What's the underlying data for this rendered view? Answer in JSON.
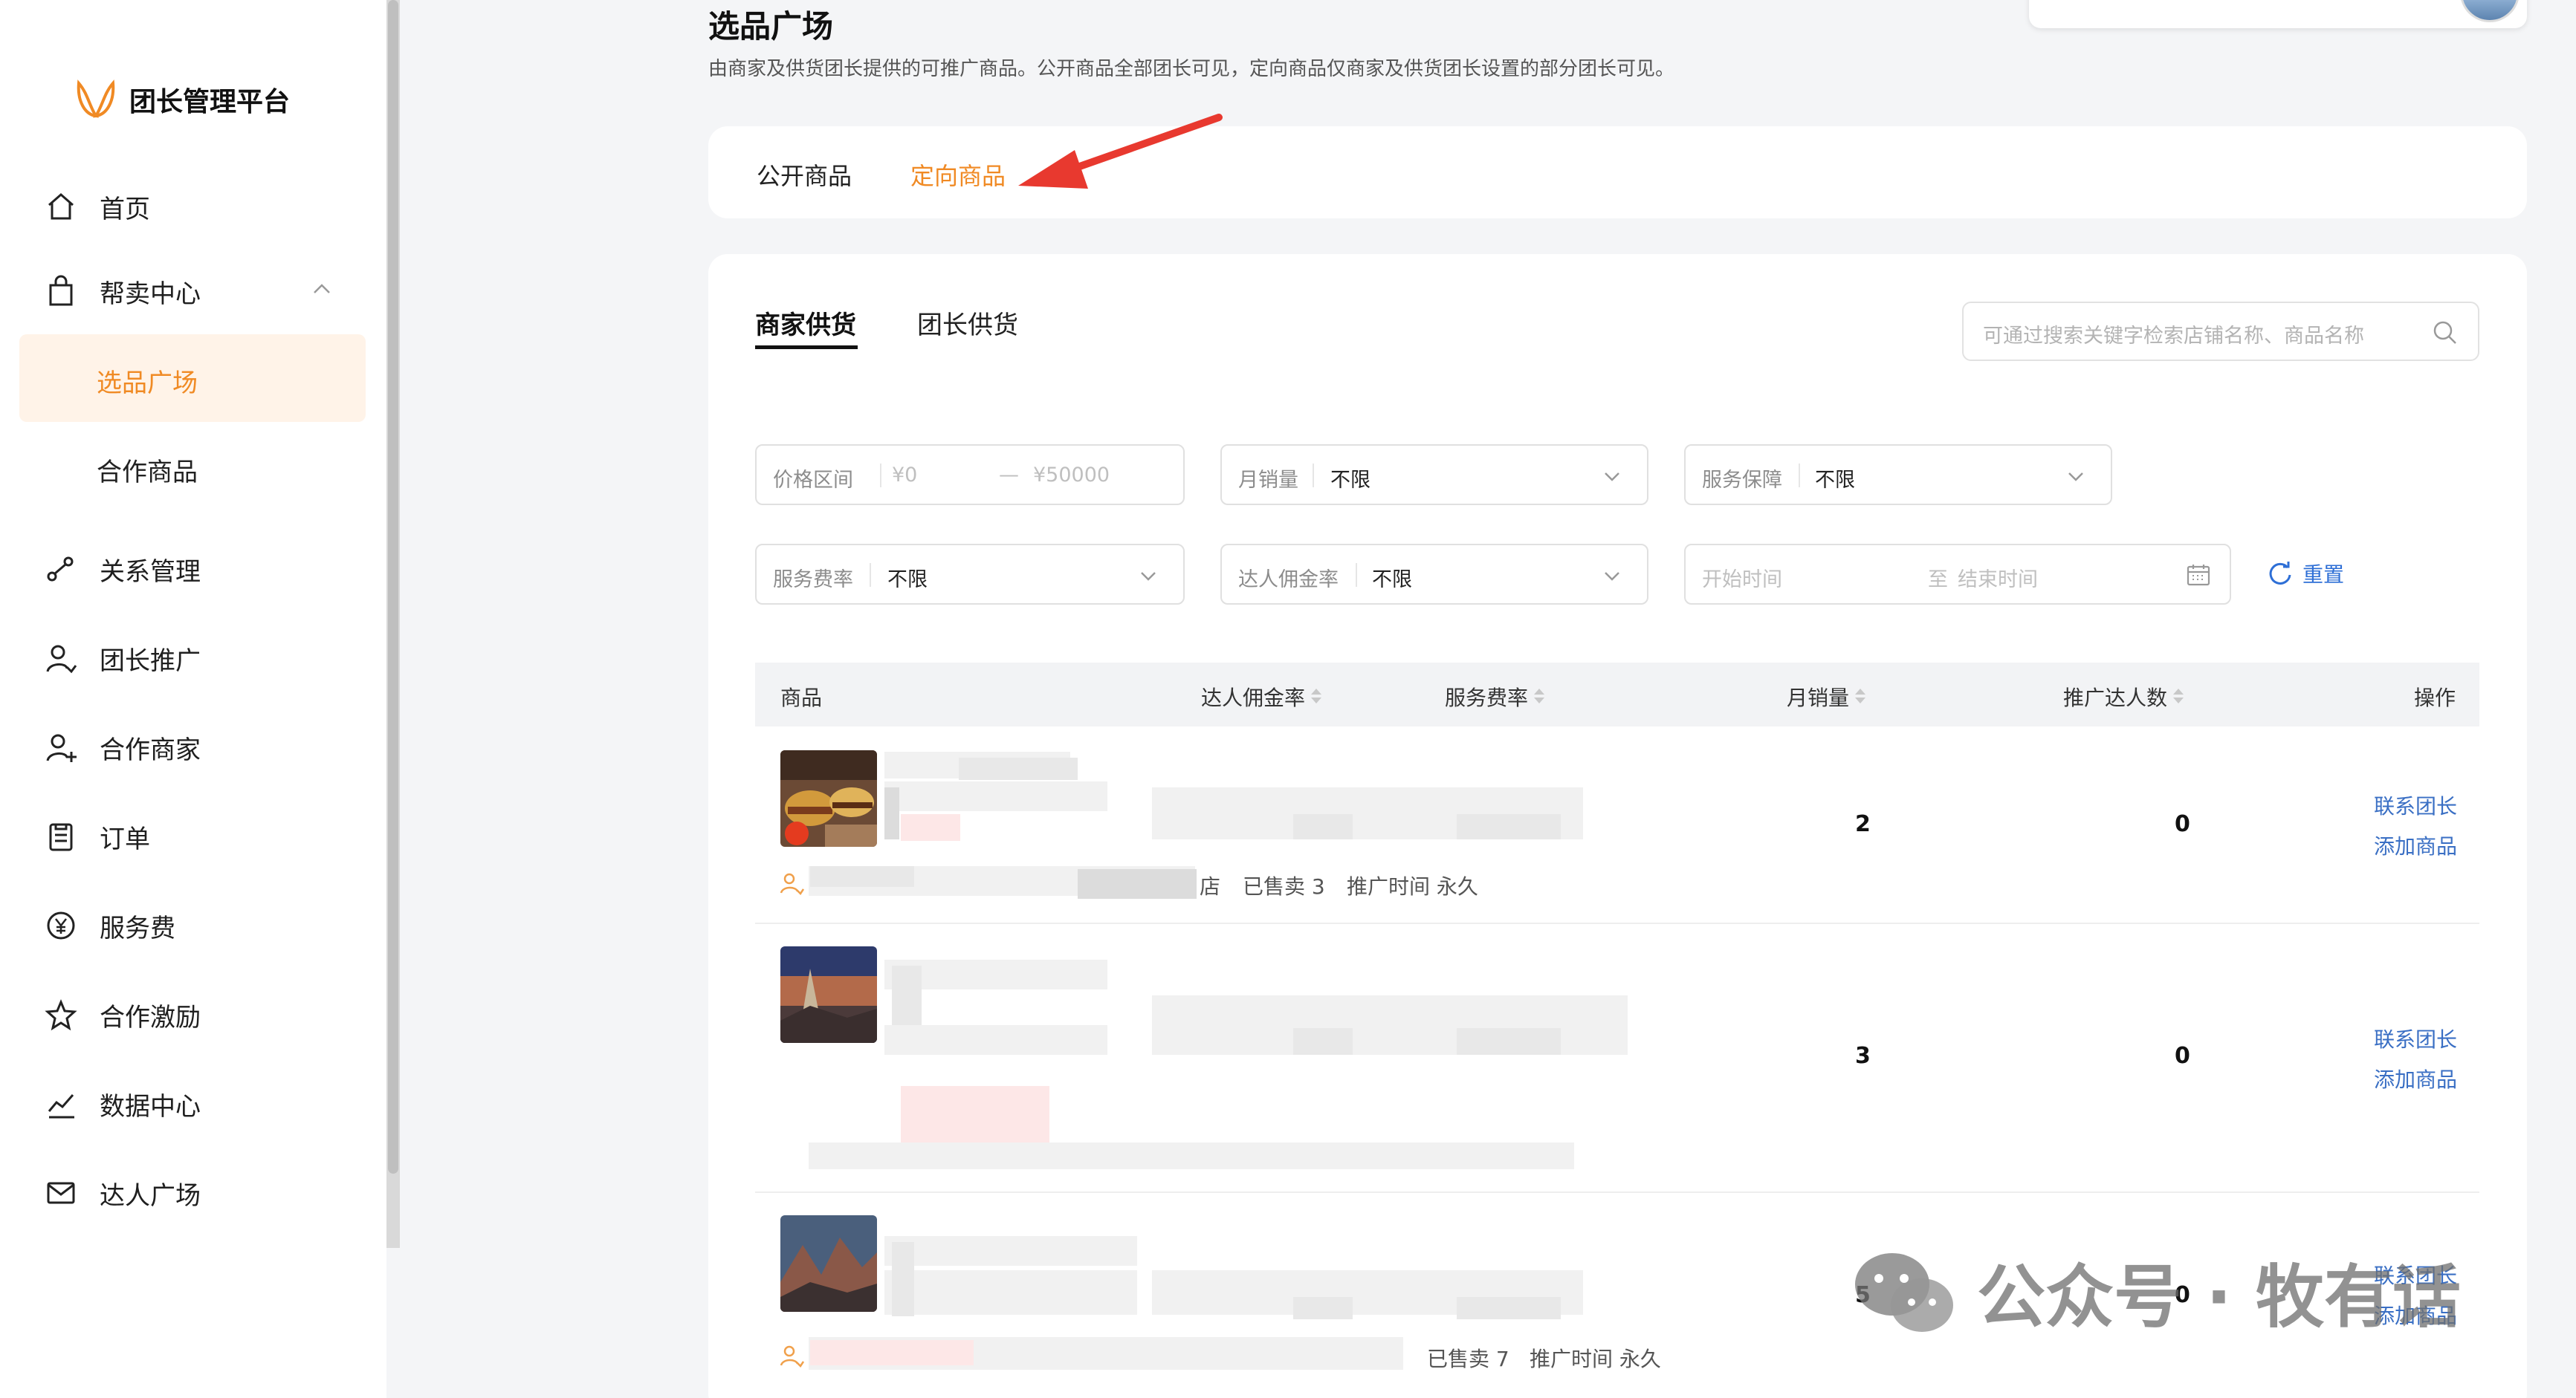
{
  "sidebar": {
    "brand": "团长管理平台",
    "items": [
      {
        "label": "首页",
        "icon": "home-icon"
      },
      {
        "label": "帮卖中心",
        "icon": "bag-icon"
      },
      {
        "label": "关系管理",
        "icon": "relation-icon"
      },
      {
        "label": "团长推广",
        "icon": "user-promote-icon"
      },
      {
        "label": "合作商家",
        "icon": "merchant-icon"
      },
      {
        "label": "订单",
        "icon": "order-icon"
      },
      {
        "label": "服务费",
        "icon": "yen-icon"
      },
      {
        "label": "合作激励",
        "icon": "star-icon"
      },
      {
        "label": "数据中心",
        "icon": "chart-icon"
      },
      {
        "label": "达人广场",
        "icon": "mail-icon"
      }
    ],
    "sub_items": [
      {
        "label": "选品广场",
        "active": true
      },
      {
        "label": "合作商品",
        "active": false
      }
    ]
  },
  "header": {
    "title": "选品广场",
    "description": "由商家及供货团长提供的可推广商品。公开商品全部团长可见，定向商品仅商家及供货团长设置的部分团长可见。"
  },
  "top_tabs": [
    {
      "label": "公开商品",
      "active": false
    },
    {
      "label": "定向商品",
      "active": true
    }
  ],
  "sub_tabs": [
    {
      "label": "商家供货",
      "active": true
    },
    {
      "label": "团长供货",
      "active": false
    }
  ],
  "search": {
    "placeholder": "可通过搜索关键字检索店铺名称、商品名称"
  },
  "filters": {
    "price": {
      "label": "价格区间",
      "min_placeholder": "¥0",
      "sep": "—",
      "max_placeholder": "¥50000"
    },
    "monthly_sales": {
      "label": "月销量",
      "value": "不限"
    },
    "service_guarantee": {
      "label": "服务保障",
      "value": "不限"
    },
    "service_fee": {
      "label": "服务费率",
      "value": "不限"
    },
    "commission": {
      "label": "达人佣金率",
      "value": "不限"
    },
    "date": {
      "start_placeholder": "开始时间",
      "to": "至",
      "end_placeholder": "结束时间"
    },
    "reset_label": "重置"
  },
  "table": {
    "columns": [
      "商品",
      "达人佣金率",
      "服务费率",
      "月销量",
      "推广达人数",
      "操作"
    ],
    "rows": [
      {
        "monthly_sales": "2",
        "promoters": "0",
        "meta_suffix": "店",
        "sold": "已售卖 3",
        "promo_time": "推广时间 永久",
        "actions": [
          "联系团长",
          "添加商品"
        ]
      },
      {
        "monthly_sales": "3",
        "promoters": "0",
        "meta_suffix": "",
        "sold": "",
        "promo_time": "",
        "actions": [
          "联系团长",
          "添加商品"
        ]
      },
      {
        "monthly_sales": "5",
        "promoters": "0",
        "meta_suffix": "",
        "sold": "已售卖 7",
        "promo_time": "推广时间 永久",
        "actions": [
          "联系团长",
          "添加商品"
        ]
      }
    ]
  },
  "watermark": {
    "text": "公众号 · 牧有话"
  },
  "colors": {
    "accent": "#f08a24",
    "link": "#3a6fc4",
    "active_bg": "#fff3e8"
  }
}
